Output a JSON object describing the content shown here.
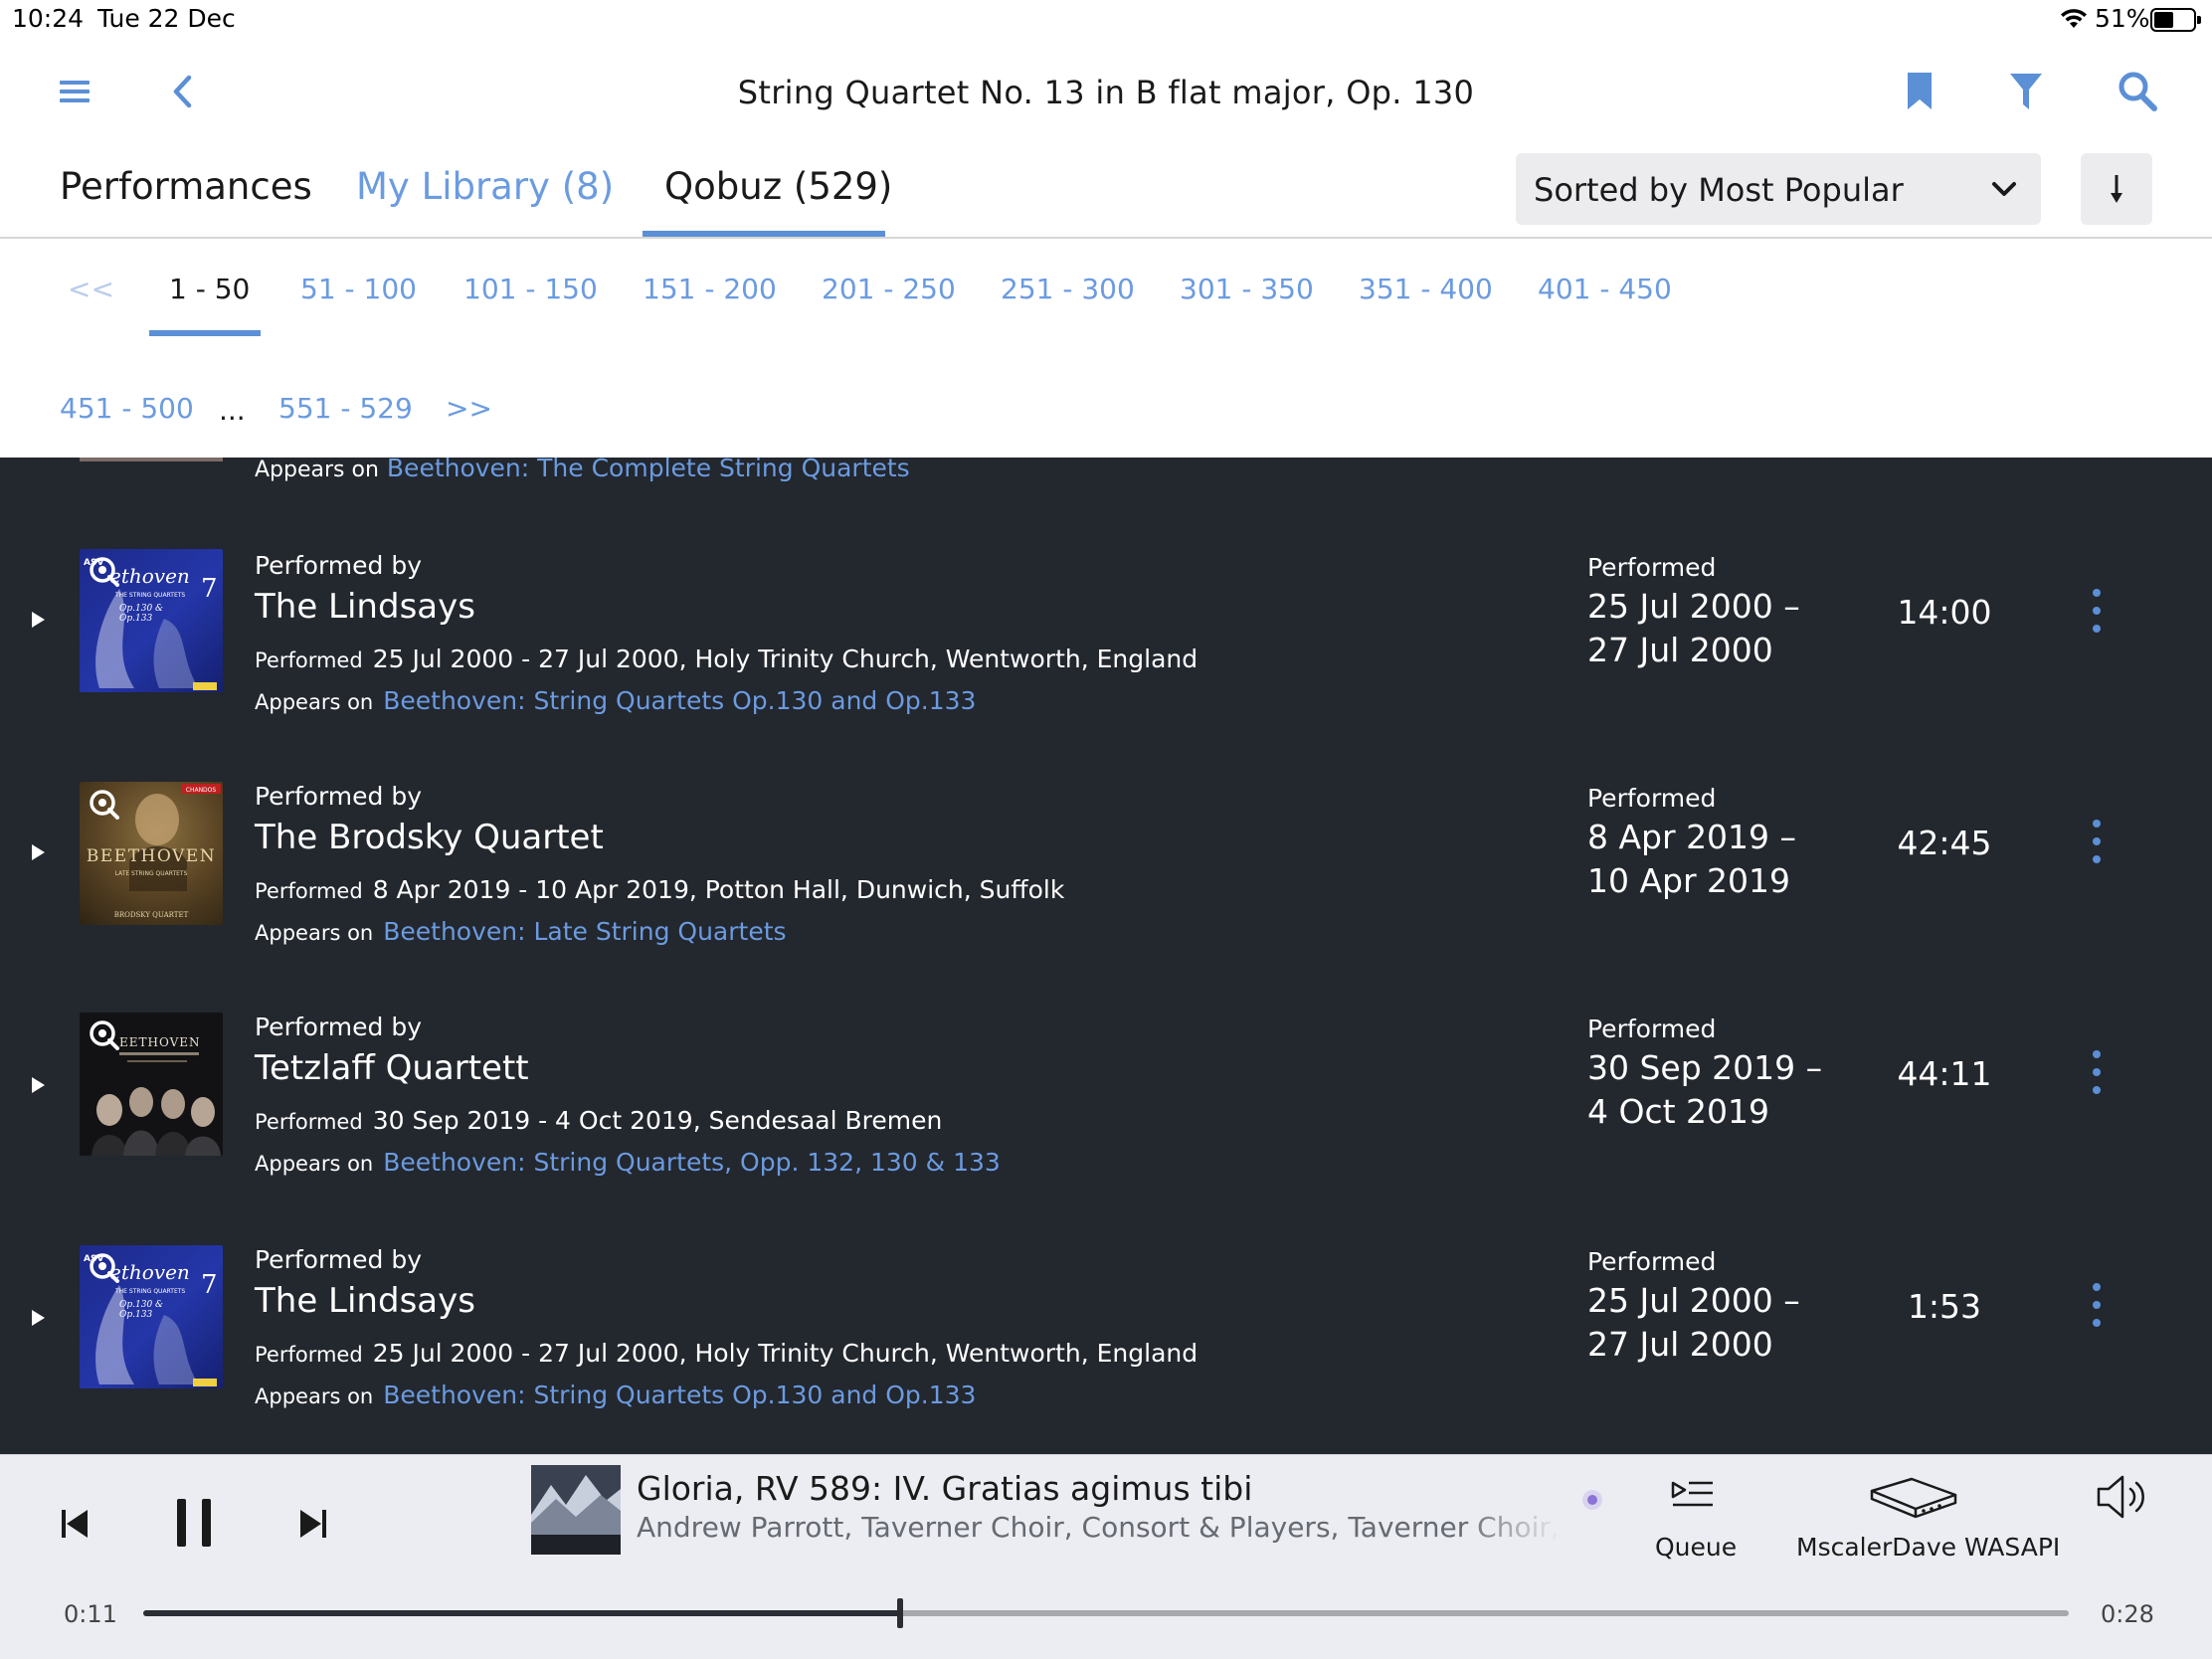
{
  "status_bar": {
    "time": "10:24",
    "date": "Tue 22 Dec",
    "battery_percent": "51%",
    "battery_level": 0.51
  },
  "header": {
    "title": "String Quartet No. 13 in B flat major, Op. 130",
    "icons": [
      "menu-icon",
      "back-icon",
      "bookmark-icon",
      "filter-icon",
      "search-icon"
    ]
  },
  "tabs": [
    {
      "label": "Performances",
      "active": false
    },
    {
      "label": "My Library (8)",
      "active": false
    },
    {
      "label": "Qobuz (529)",
      "active": true
    }
  ],
  "sort": {
    "label": "Sorted by Most Popular",
    "direction_icon": "arrow-down-icon"
  },
  "pagination": {
    "first": "<<",
    "last": ">>",
    "ellipsis": "...",
    "pages": [
      "1 - 50",
      "51 - 100",
      "101 - 150",
      "151 - 200",
      "201 - 250",
      "251 - 300",
      "301 - 350",
      "351 - 400",
      "401 - 450",
      "451 - 500",
      "551 - 529"
    ],
    "current": "1 - 50"
  },
  "labels": {
    "performed_by": "Performed by",
    "performed": "Performed",
    "appears_on": "Appears on"
  },
  "partial_row": {
    "appears_on": "Beethoven: The Complete String Quartets"
  },
  "performances": [
    {
      "ensemble": "The Lindsays",
      "details": "25 Jul 2000 - 27 Jul 2000, Holy Trinity Church, Wentworth, England",
      "appears_on": "Beethoven: String Quartets Op.130 and Op.133",
      "date_line1": "25 Jul 2000 –",
      "date_line2": "27 Jul 2000",
      "duration": "14:00",
      "art": "lindsays"
    },
    {
      "ensemble": "The Brodsky Quartet",
      "details": "8 Apr 2019 - 10 Apr 2019, Potton Hall, Dunwich, Suffolk",
      "appears_on": "Beethoven: Late String Quartets",
      "date_line1": "8 Apr 2019 –",
      "date_line2": "10 Apr 2019",
      "duration": "42:45",
      "art": "brodsky"
    },
    {
      "ensemble": "Tetzlaff Quartett",
      "details": "30 Sep 2019 - 4 Oct 2019, Sendesaal Bremen",
      "appears_on": "Beethoven: String Quartets, Opp. 132, 130 & 133",
      "date_line1": "30 Sep 2019 –",
      "date_line2": "4 Oct 2019",
      "duration": "44:11",
      "art": "tetzlaff"
    },
    {
      "ensemble": "The Lindsays",
      "details": "25 Jul 2000 - 27 Jul 2000, Holy Trinity Church, Wentworth, England",
      "appears_on": "Beethoven: String Quartets Op.130 and Op.133",
      "date_line1": "25 Jul 2000 –",
      "date_line2": "27 Jul 2000",
      "duration": "1:53",
      "art": "lindsays"
    }
  ],
  "album_art_text": {
    "lindsays_title": "ethoven",
    "lindsays_number": "7",
    "lindsays_sub1": "THE STRING QUARTETS",
    "lindsays_sub2": "Op.130 &",
    "lindsays_sub3": "Op.133",
    "lindsays_logo": "ASV",
    "brodsky_title": "BEETHOVEN",
    "brodsky_sub": "LATE STRING QUARTETS",
    "brodsky_bottom": "BRODSKY QUARTET",
    "brodsky_label": "CHANDOS",
    "tetzlaff_title": "EETHOVEN"
  },
  "now_playing": {
    "title": "Gloria, RV 589: IV. Gratias agimus tibi",
    "artist": "Andrew Parrott, Taverner Choir, Consort & Players, Taverner Choir, Taverner Players",
    "elapsed": "0:11",
    "total": "0:28",
    "progress": 0.393,
    "queue_label": "Queue",
    "device_label": "MscalerDave WASAPI"
  },
  "colors": {
    "accent": "#5b8fd6",
    "link": "#6b9be0",
    "list_bg": "#23272e",
    "player_bg": "#ecedf2"
  }
}
